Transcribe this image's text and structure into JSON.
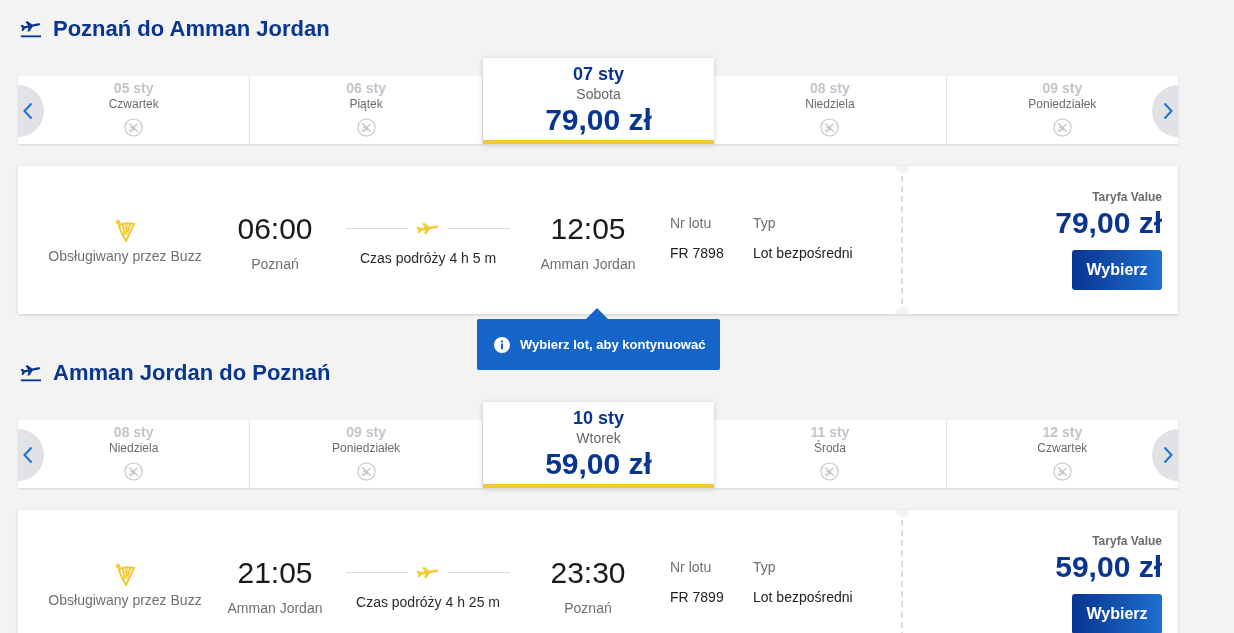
{
  "journeys": [
    {
      "heading": "Poznań do Amman Jordan",
      "dates": [
        {
          "date": "05 sty",
          "day": "Czwartek",
          "selected": false
        },
        {
          "date": "06 sty",
          "day": "Piątek",
          "selected": false
        },
        {
          "date": "07 sty",
          "day": "Sobota",
          "price": "79,00 zł",
          "selected": true
        },
        {
          "date": "08 sty",
          "day": "Niedziela",
          "selected": false
        },
        {
          "date": "09 sty",
          "day": "Poniedziałek",
          "selected": false
        }
      ],
      "flight": {
        "operator": "Obsługiwany przez Buzz",
        "departure_time": "06:00",
        "departure_city": "Poznań",
        "duration": "Czas podróży 4 h 5 m",
        "arrival_time": "12:05",
        "arrival_city": "Amman Jordan",
        "flight_number_label": "Nr lotu",
        "flight_number": "FR 7898",
        "type_label": "Typ",
        "type": "Lot bezpośredni",
        "fare_label": "Taryfa Value",
        "fare_price": "79,00 zł",
        "button": "Wybierz"
      },
      "tooltip": "Wybierz lot, aby kontynuować"
    },
    {
      "heading": "Amman Jordan do Poznań",
      "dates": [
        {
          "date": "08 sty",
          "day": "Niedziela",
          "selected": false
        },
        {
          "date": "09 sty",
          "day": "Poniedziałek",
          "selected": false
        },
        {
          "date": "10 sty",
          "day": "Wtorek",
          "price": "59,00 zł",
          "selected": true
        },
        {
          "date": "11 sty",
          "day": "Środa",
          "selected": false
        },
        {
          "date": "12 sty",
          "day": "Czwartek",
          "selected": false
        }
      ],
      "flight": {
        "operator": "Obsługiwany przez Buzz",
        "departure_time": "21:05",
        "departure_city": "Amman Jordan",
        "duration": "Czas podróży 4 h 25 m",
        "arrival_time": "23:30",
        "arrival_city": "Poznań",
        "flight_number_label": "Nr lotu",
        "flight_number": "FR 7899",
        "type_label": "Typ",
        "type": "Lot bezpośredni",
        "fare_label": "Taryfa Value",
        "fare_price": "59,00 zł",
        "button": "Wybierz"
      }
    }
  ]
}
